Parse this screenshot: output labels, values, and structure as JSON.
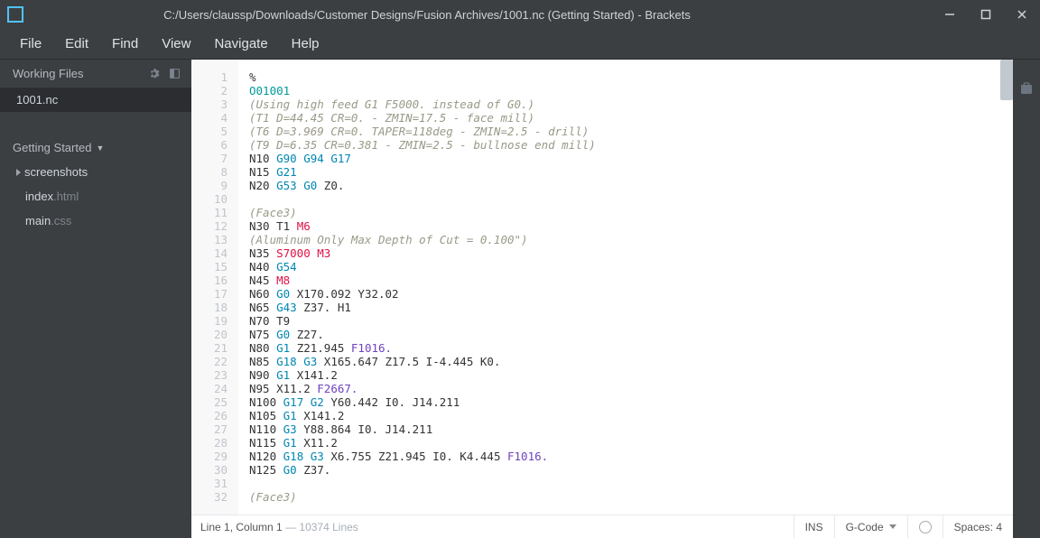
{
  "title_bar": {
    "text": "C:/Users/claussp/Downloads/Customer Designs/Fusion Archives/1001.nc (Getting Started) - Brackets"
  },
  "menu": [
    "File",
    "Edit",
    "Find",
    "View",
    "Navigate",
    "Help"
  ],
  "sidebar": {
    "working_files_header": "Working Files",
    "working_files": [
      "1001.nc"
    ],
    "project": "Getting Started",
    "folder": "screenshots",
    "files": [
      {
        "base": "index",
        "ext": ".html"
      },
      {
        "base": "main",
        "ext": ".css"
      }
    ]
  },
  "code_lines": [
    {
      "n": 1,
      "t": [
        {
          "c": "tok-pct",
          "s": "%"
        }
      ]
    },
    {
      "n": 2,
      "t": [
        {
          "c": "tok-o",
          "s": "O01001"
        }
      ]
    },
    {
      "n": 3,
      "t": [
        {
          "c": "tok-cmt",
          "s": "(Using high feed G1 F5000. instead of G0.)"
        }
      ]
    },
    {
      "n": 4,
      "t": [
        {
          "c": "tok-cmt",
          "s": "(T1 D=44.45 CR=0. - ZMIN=17.5 - face mill)"
        }
      ]
    },
    {
      "n": 5,
      "t": [
        {
          "c": "tok-cmt",
          "s": "(T6 D=3.969 CR=0. TAPER=118deg - ZMIN=2.5 - drill)"
        }
      ]
    },
    {
      "n": 6,
      "t": [
        {
          "c": "tok-cmt",
          "s": "(T9 D=6.35 CR=0.381 - ZMIN=2.5 - bullnose end mill)"
        }
      ]
    },
    {
      "n": 7,
      "t": [
        {
          "c": "",
          "s": "N10 "
        },
        {
          "c": "tok-g",
          "s": "G90 G94 G17"
        }
      ]
    },
    {
      "n": 8,
      "t": [
        {
          "c": "",
          "s": "N15 "
        },
        {
          "c": "tok-g",
          "s": "G21"
        }
      ]
    },
    {
      "n": 9,
      "t": [
        {
          "c": "",
          "s": "N20 "
        },
        {
          "c": "tok-g",
          "s": "G53 G0"
        },
        {
          "c": "",
          "s": " Z0."
        }
      ]
    },
    {
      "n": 10,
      "t": [
        {
          "c": "",
          "s": ""
        }
      ]
    },
    {
      "n": 11,
      "t": [
        {
          "c": "tok-cmt",
          "s": "(Face3)"
        }
      ]
    },
    {
      "n": 12,
      "t": [
        {
          "c": "",
          "s": "N30 T1 "
        },
        {
          "c": "tok-m",
          "s": "M6"
        }
      ]
    },
    {
      "n": 13,
      "t": [
        {
          "c": "tok-cmt",
          "s": "(Aluminum Only Max Depth of Cut = 0.100\")"
        }
      ]
    },
    {
      "n": 14,
      "t": [
        {
          "c": "",
          "s": "N35 "
        },
        {
          "c": "tok-m",
          "s": "S7000 M3"
        }
      ]
    },
    {
      "n": 15,
      "t": [
        {
          "c": "",
          "s": "N40 "
        },
        {
          "c": "tok-g",
          "s": "G54"
        }
      ]
    },
    {
      "n": 16,
      "t": [
        {
          "c": "",
          "s": "N45 "
        },
        {
          "c": "tok-m",
          "s": "M8"
        }
      ]
    },
    {
      "n": 17,
      "t": [
        {
          "c": "",
          "s": "N60 "
        },
        {
          "c": "tok-g",
          "s": "G0"
        },
        {
          "c": "",
          "s": " X170.092 Y32.02"
        }
      ]
    },
    {
      "n": 18,
      "t": [
        {
          "c": "",
          "s": "N65 "
        },
        {
          "c": "tok-g",
          "s": "G43"
        },
        {
          "c": "",
          "s": " Z37. H1"
        }
      ]
    },
    {
      "n": 19,
      "t": [
        {
          "c": "",
          "s": "N70 T9"
        }
      ]
    },
    {
      "n": 20,
      "t": [
        {
          "c": "",
          "s": "N75 "
        },
        {
          "c": "tok-g",
          "s": "G0"
        },
        {
          "c": "",
          "s": " Z27."
        }
      ]
    },
    {
      "n": 21,
      "t": [
        {
          "c": "",
          "s": "N80 "
        },
        {
          "c": "tok-g",
          "s": "G1"
        },
        {
          "c": "",
          "s": " Z21.945 "
        },
        {
          "c": "tok-f",
          "s": "F1016."
        }
      ]
    },
    {
      "n": 22,
      "t": [
        {
          "c": "",
          "s": "N85 "
        },
        {
          "c": "tok-g",
          "s": "G18 G3"
        },
        {
          "c": "",
          "s": " X165.647 Z17.5 I-4.445 K0."
        }
      ]
    },
    {
      "n": 23,
      "t": [
        {
          "c": "",
          "s": "N90 "
        },
        {
          "c": "tok-g",
          "s": "G1"
        },
        {
          "c": "",
          "s": " X141.2"
        }
      ]
    },
    {
      "n": 24,
      "t": [
        {
          "c": "",
          "s": "N95 X11.2 "
        },
        {
          "c": "tok-f",
          "s": "F2667."
        }
      ]
    },
    {
      "n": 25,
      "t": [
        {
          "c": "",
          "s": "N100 "
        },
        {
          "c": "tok-g",
          "s": "G17 G2"
        },
        {
          "c": "",
          "s": " Y60.442 I0. J14.211"
        }
      ]
    },
    {
      "n": 26,
      "t": [
        {
          "c": "",
          "s": "N105 "
        },
        {
          "c": "tok-g",
          "s": "G1"
        },
        {
          "c": "",
          "s": " X141.2"
        }
      ]
    },
    {
      "n": 27,
      "t": [
        {
          "c": "",
          "s": "N110 "
        },
        {
          "c": "tok-g",
          "s": "G3"
        },
        {
          "c": "",
          "s": " Y88.864 I0. J14.211"
        }
      ]
    },
    {
      "n": 28,
      "t": [
        {
          "c": "",
          "s": "N115 "
        },
        {
          "c": "tok-g",
          "s": "G1"
        },
        {
          "c": "",
          "s": " X11.2"
        }
      ]
    },
    {
      "n": 29,
      "t": [
        {
          "c": "",
          "s": "N120 "
        },
        {
          "c": "tok-g",
          "s": "G18 G3"
        },
        {
          "c": "",
          "s": " X6.755 Z21.945 I0. K4.445 "
        },
        {
          "c": "tok-f",
          "s": "F1016."
        }
      ]
    },
    {
      "n": 30,
      "t": [
        {
          "c": "",
          "s": "N125 "
        },
        {
          "c": "tok-g",
          "s": "G0"
        },
        {
          "c": "",
          "s": " Z37."
        }
      ]
    },
    {
      "n": 31,
      "t": [
        {
          "c": "",
          "s": ""
        }
      ]
    },
    {
      "n": 32,
      "t": [
        {
          "c": "tok-cmt",
          "s": "(Face3)"
        }
      ]
    }
  ],
  "status": {
    "cursor": "Line 1, Column 1",
    "lines": " — 10374 Lines",
    "ins": "INS",
    "lang": "G-Code",
    "spaces": "Spaces:  4"
  }
}
